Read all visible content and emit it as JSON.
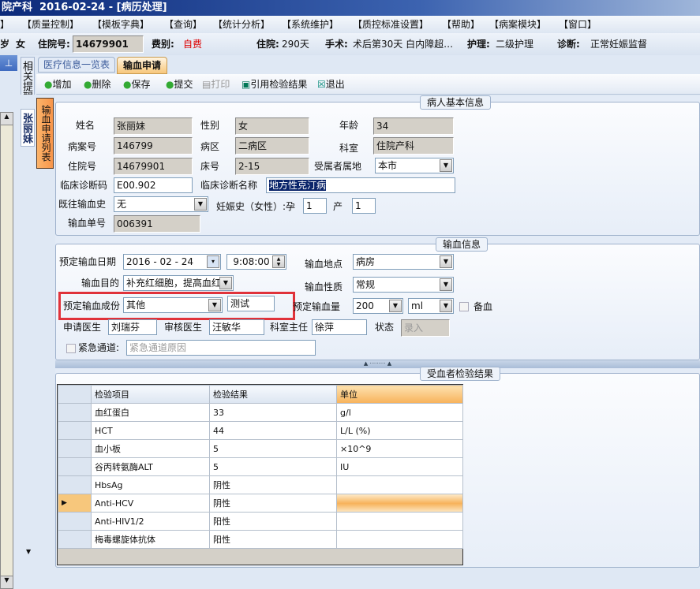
{
  "window": {
    "title": "院产科  2016-02-24 - [病历处理]"
  },
  "menu": [
    "】",
    "【质量控制】",
    "【模板字典】",
    "【查询】",
    "【统计分析】",
    "【系统维护】",
    "【质控标准设置】",
    "【帮助】",
    "【病案模块】",
    "【窗口】"
  ],
  "patient_bar": {
    "age_suffix": "岁",
    "sex": "女",
    "inpatient_no_label": "住院号:",
    "inpatient_no": "14679901",
    "fee_label": "费别:",
    "fee": "自费",
    "stay_label": "住院:",
    "stay": "290天",
    "surgery_label": "手术:",
    "surgery": "术后第30天 白内障超…",
    "nursing_label": "护理:",
    "nursing": "二级护理",
    "diagnosis_label": "诊断:",
    "diagnosis": "正常妊娠监督"
  },
  "side_tabs": {
    "related": "相关提醒",
    "patient": "张丽妹",
    "list": "输血申请列表"
  },
  "tabs": [
    {
      "label": "医疗信息一览表",
      "active": false
    },
    {
      "label": "输血申请",
      "active": true
    }
  ],
  "toolbar": {
    "add": "增加",
    "delete": "删除",
    "save": "保存",
    "submit": "提交",
    "print": "打印",
    "cite": "引用检验结果",
    "exit": "退出"
  },
  "basic": {
    "title": "病人基本信息",
    "name_label": "姓名",
    "name": "张丽妹",
    "sex_label": "性别",
    "sex": "女",
    "age_label": "年龄",
    "age": "34",
    "case_label": "病案号",
    "case": "146799",
    "ward_label": "病区",
    "ward": "二病区",
    "dept_label": "科室",
    "dept": "住院产科",
    "inpatient_label": "住院号",
    "inpatient": "14679901",
    "bed_label": "床号",
    "bed": "2-15",
    "locale_label": "受属者属地",
    "locale": "本市",
    "diag_code_label": "临床诊断码",
    "diag_code": "E00.902",
    "diag_name_label": "临床诊断名称",
    "diag_name": "地方性克汀病",
    "history_label": "既往输血史",
    "history": "无",
    "preg_label": "妊娠史（女性）:孕",
    "preg": "1",
    "birth_label": "产",
    "birth": "1",
    "order_label": "输血单号",
    "order": "006391"
  },
  "transfusion": {
    "title": "输血信息",
    "date_label": "预定输血日期",
    "date": "2016 - 02 - 24",
    "time": "9:08:00",
    "place_label": "输血地点",
    "place": "病房",
    "purpose_label": "输血目的",
    "purpose": "补充红细胞，提高血红",
    "nature_label": "输血性质",
    "nature": "常规",
    "component_label": "预定输血成份",
    "component": "其他",
    "component_note": "测试",
    "amount_label": "预定输血量",
    "amount": "200",
    "unit": "ml",
    "reserve_label": "备血",
    "doctor_label": "申请医生",
    "doctor": "刘瑞芬",
    "reviewer_label": "审核医生",
    "reviewer": "汪敏华",
    "director_label": "科室主任",
    "director": "徐萍",
    "status_label": "状态",
    "status": "录入",
    "emergency_label": "紧急通道:",
    "emergency_placeholder": "紧急通道原因"
  },
  "results": {
    "title": "受血者检验结果",
    "columns": [
      "检验项目",
      "检验结果",
      "单位"
    ],
    "rows": [
      [
        "血红蛋白",
        "33",
        "g/l"
      ],
      [
        "HCT",
        "44",
        "L/L (%)"
      ],
      [
        "血小板",
        "5",
        "×10^9"
      ],
      [
        "谷丙转氨酶ALT",
        "5",
        "IU"
      ],
      [
        "HbsAg",
        "阴性",
        ""
      ],
      [
        "Anti-HCV",
        "阴性",
        ""
      ],
      [
        "Anti-HIV1/2",
        "阳性",
        ""
      ],
      [
        "梅毒螺旋体抗体",
        "阳性",
        ""
      ]
    ],
    "selected_row": 5
  },
  "colors": {
    "highlight_box": "#e0323a",
    "accent_orange": "#f7b25a",
    "title_blue": "#0c2a7a"
  }
}
